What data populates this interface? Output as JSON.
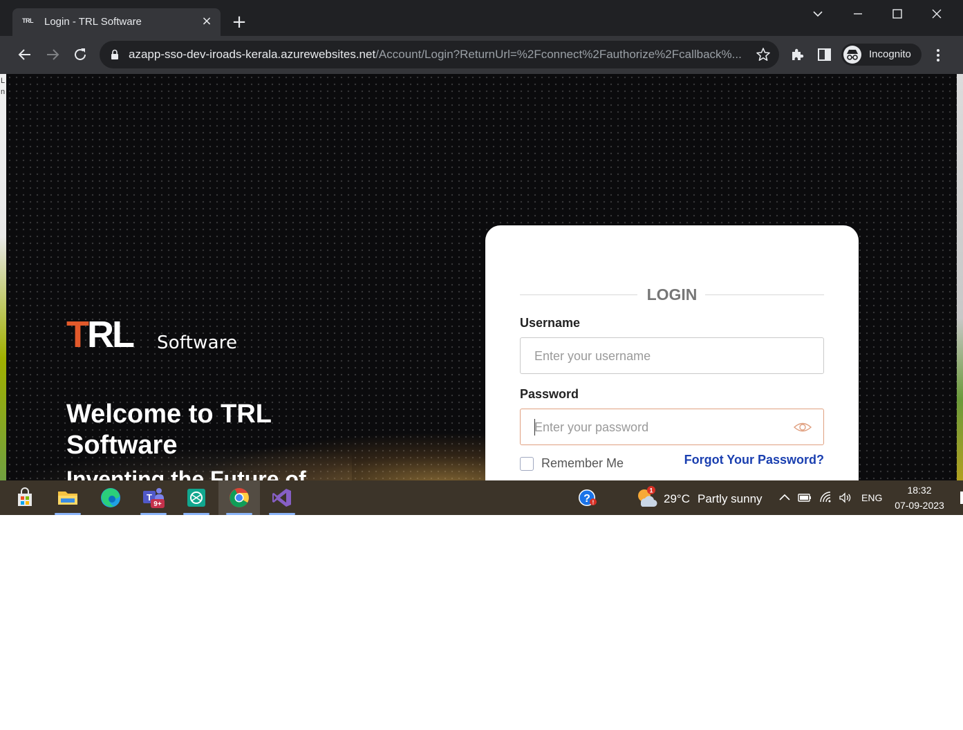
{
  "browser": {
    "tab_title": "Login - TRL Software",
    "tab_favicon_text": "TRL",
    "url_host": "azapp-sso-dev-iroads-kerala.azurewebsites.net",
    "url_path": "/Account/Login?ReturnUrl=%2Fconnect%2Fauthorize%2Fcallback%...",
    "profile_label": "Incognito"
  },
  "page": {
    "left_strip_text": "L\nn",
    "logo_mark": "TRL",
    "logo_word": "Software",
    "welcome_heading": "Welcome to TRL Software",
    "tagline": "Inventing the Future of"
  },
  "login": {
    "heading": "LOGIN",
    "username_label": "Username",
    "username_placeholder": "Enter your username",
    "password_label": "Password",
    "password_placeholder": "Enter your password",
    "remember_label": "Remember Me",
    "forgot_label": "Forgot Your Password?"
  },
  "taskbar": {
    "teams_badge": "9+",
    "weather_badge": "1",
    "temperature": "29°C",
    "weather": "Partly sunny",
    "language": "ENG",
    "time": "18:32",
    "date": "07-09-2023"
  },
  "colors": {
    "brand_orange": "#e2592b",
    "link_blue": "#1a3fb0",
    "chrome_dark": "#202124",
    "taskbar": "#3c3429"
  }
}
